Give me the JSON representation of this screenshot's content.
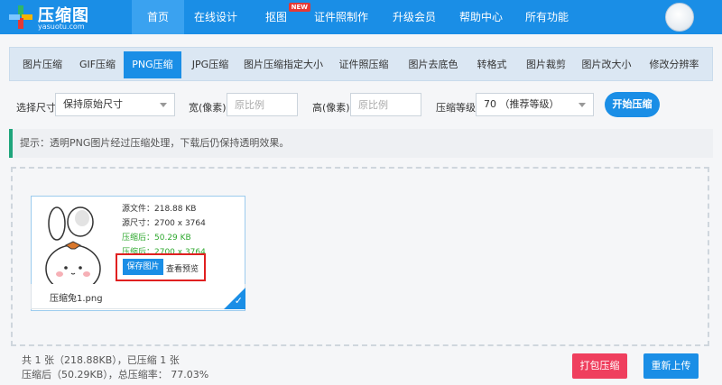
{
  "header": {
    "logo_title": "压缩图",
    "logo_sub": "yasuotu.com",
    "brand_colors": {
      "blue": "#1a8ee6",
      "red": "#e53935",
      "green": "#2fb56a"
    },
    "nav": [
      {
        "label": "首页",
        "active": true
      },
      {
        "label": "在线设计"
      },
      {
        "label": "抠图",
        "badge": "NEW"
      },
      {
        "label": "证件照制作"
      },
      {
        "label": "升级会员"
      },
      {
        "label": "帮助中心"
      },
      {
        "label": "所有功能"
      }
    ]
  },
  "tabs": [
    "图片压缩",
    "GIF压缩",
    "PNG压缩",
    "JPG压缩",
    "图片压缩指定大小",
    "证件照压缩",
    "图片去底色",
    "转格式",
    "图片裁剪",
    "图片改大小",
    "修改分辨率"
  ],
  "active_tab": "PNG压缩",
  "options": {
    "size_label": "选择尺寸",
    "size_value": "保持原始尺寸",
    "width_label": "宽(像素)",
    "width_placeholder": "原比例",
    "height_label": "高(像素)",
    "height_placeholder": "原比例",
    "level_label": "压缩等级",
    "level_value": "70 （推荐等级）",
    "start_button": "开始压缩"
  },
  "tip": "提示：透明PNG图片经过压缩处理，下载后仍保持透明效果。",
  "file": {
    "src_file": "源文件：218.88 KB",
    "src_size": "源尺寸：2700 x 3764",
    "after_file": "压缩后：50.29 KB",
    "after_size": "压缩后：2700 x 3764",
    "save_button": "保存图片",
    "preview_link": "查看预览",
    "name": "压缩兔1.png",
    "check": "✓"
  },
  "stats": {
    "line1": "共 1 张（218.88KB），已压缩 1 张",
    "line2": "压缩后（50.29KB），总压缩率： 77.03%"
  },
  "buttons": {
    "pack": "打包压缩",
    "reupload": "重新上传"
  }
}
